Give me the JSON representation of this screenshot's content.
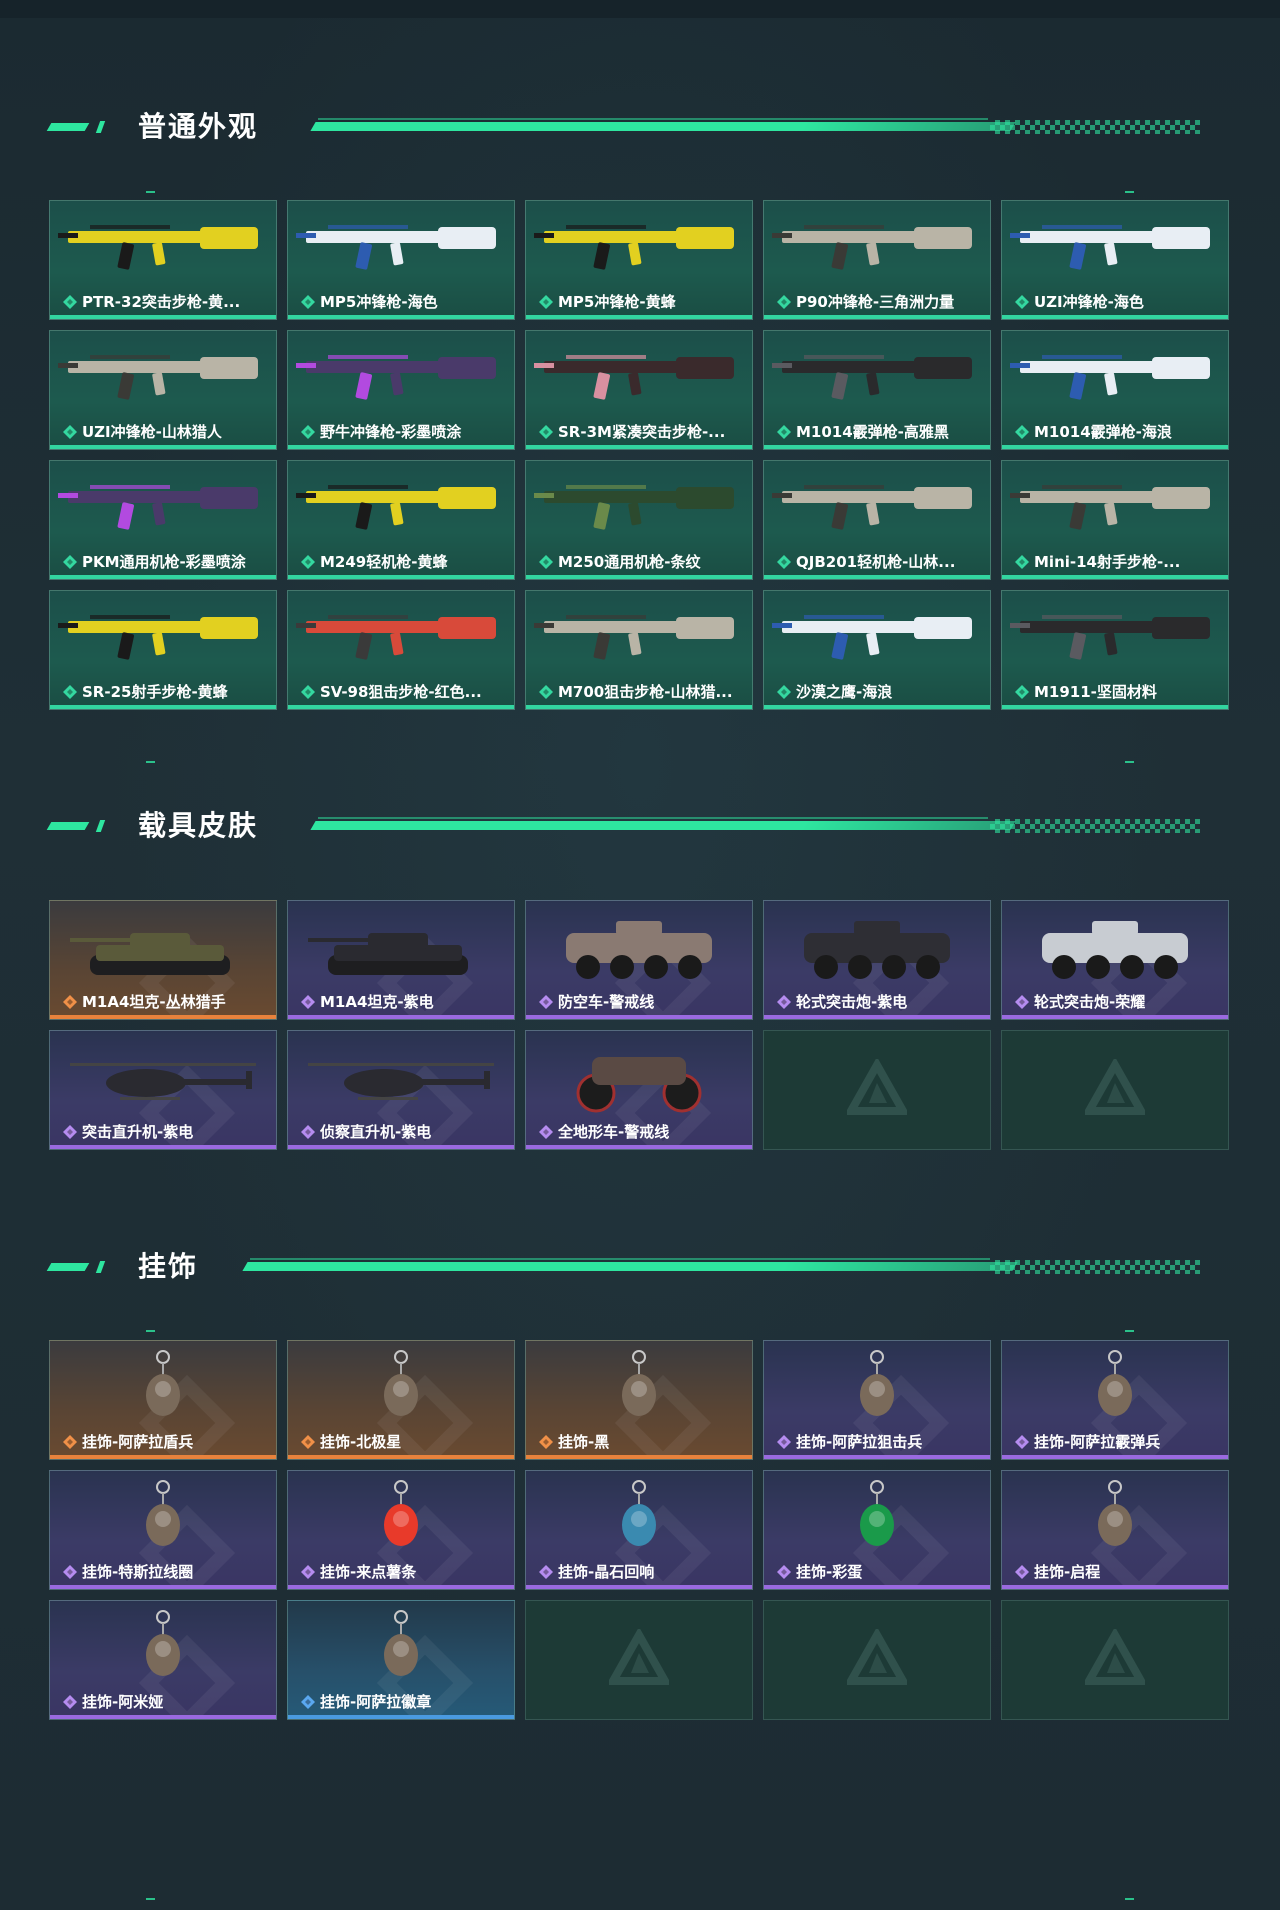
{
  "colors": {
    "accent": "#2ee6a0",
    "green_card": "#1d5a4e",
    "purple_card": "#3b3b66",
    "orange_card": "#6a4a30",
    "blue_card": "#255a78"
  },
  "sections": {
    "weapons": {
      "title": "普通外观",
      "items": [
        {
          "label": "PTR-32突击步枪-黄...",
          "rarity": "green",
          "icon": "rifle-yellow-icon"
        },
        {
          "label": "MP5冲锋枪-海色",
          "rarity": "green",
          "icon": "smg-white-blue-icon"
        },
        {
          "label": "MP5冲锋枪-黄蜂",
          "rarity": "green",
          "icon": "smg-yellow-icon"
        },
        {
          "label": "P90冲锋枪-三角洲力量",
          "rarity": "green",
          "icon": "p90-camo-icon"
        },
        {
          "label": "UZI冲锋枪-海色",
          "rarity": "green",
          "icon": "uzi-white-icon"
        },
        {
          "label": "UZI冲锋枪-山林猎人",
          "rarity": "green",
          "icon": "uzi-camo-icon"
        },
        {
          "label": "野牛冲锋枪-彩墨喷涂",
          "rarity": "green",
          "icon": "bizon-purple-icon"
        },
        {
          "label": "SR-3M紧凑突击步枪-...",
          "rarity": "green",
          "icon": "sr3m-pink-icon"
        },
        {
          "label": "M1014霰弹枪-高雅黑",
          "rarity": "green",
          "icon": "shotgun-black-icon"
        },
        {
          "label": "M1014霰弹枪-海浪",
          "rarity": "green",
          "icon": "shotgun-blue-icon"
        },
        {
          "label": "PKM通用机枪-彩墨喷涂",
          "rarity": "green",
          "icon": "pkm-purple-icon"
        },
        {
          "label": "M249轻机枪-黄蜂",
          "rarity": "green",
          "icon": "m249-yellow-icon"
        },
        {
          "label": "M250通用机枪-条纹",
          "rarity": "green",
          "icon": "m250-green-icon"
        },
        {
          "label": "QJB201轻机枪-山林...",
          "rarity": "green",
          "icon": "qjb201-camo-icon"
        },
        {
          "label": "Mini-14射手步枪-...",
          "rarity": "green",
          "icon": "mini14-camo-icon"
        },
        {
          "label": "SR-25射手步枪-黄蜂",
          "rarity": "green",
          "icon": "sr25-yellow-icon"
        },
        {
          "label": "SV-98狙击步枪-红色...",
          "rarity": "green",
          "icon": "sv98-red-icon"
        },
        {
          "label": "M700狙击步枪-山林猎...",
          "rarity": "green",
          "icon": "m700-camo-icon"
        },
        {
          "label": "沙漠之鹰-海浪",
          "rarity": "green",
          "icon": "deagle-blue-icon"
        },
        {
          "label": "M1911-坚固材料",
          "rarity": "green",
          "icon": "m1911-black-icon"
        }
      ]
    },
    "vehicles": {
      "title": "载具皮肤",
      "items": [
        {
          "label": "M1A4坦克-丛林猎手",
          "rarity": "orange",
          "icon": "tank-camo-icon"
        },
        {
          "label": "M1A4坦克-紫电",
          "rarity": "purple",
          "icon": "tank-dark-icon"
        },
        {
          "label": "防空车-警戒线",
          "rarity": "purple",
          "icon": "aa-vehicle-icon"
        },
        {
          "label": "轮式突击炮-紫电",
          "rarity": "purple",
          "icon": "wheeled-gun-dark-icon"
        },
        {
          "label": "轮式突击炮-荣耀",
          "rarity": "purple",
          "icon": "wheeled-gun-white-icon"
        },
        {
          "label": "突击直升机-紫电",
          "rarity": "purple",
          "icon": "attack-heli-icon"
        },
        {
          "label": "侦察直升机-紫电",
          "rarity": "purple",
          "icon": "scout-heli-icon"
        },
        {
          "label": "全地形车-警戒线",
          "rarity": "purple",
          "icon": "atv-icon"
        },
        {
          "label": "",
          "rarity": "empty",
          "icon": "empty-slot-icon"
        },
        {
          "label": "",
          "rarity": "empty",
          "icon": "empty-slot-icon"
        }
      ]
    },
    "charms": {
      "title": "挂饰",
      "items": [
        {
          "label": "挂饰-阿萨拉盾兵",
          "rarity": "orange",
          "icon": "charm-shield-soldier-icon"
        },
        {
          "label": "挂饰-北极星",
          "rarity": "orange",
          "icon": "charm-polaris-icon"
        },
        {
          "label": "挂饰-黑",
          "rarity": "orange",
          "icon": "charm-black-icon"
        },
        {
          "label": "挂饰-阿萨拉狙击兵",
          "rarity": "purple",
          "icon": "charm-sniper-icon"
        },
        {
          "label": "挂饰-阿萨拉霰弹兵",
          "rarity": "purple",
          "icon": "charm-shotgunner-icon"
        },
        {
          "label": "挂饰-特斯拉线圈",
          "rarity": "purple",
          "icon": "charm-tesla-coil-icon"
        },
        {
          "label": "挂饰-来点薯条",
          "rarity": "purple",
          "icon": "charm-fries-icon"
        },
        {
          "label": "挂饰-晶石回响",
          "rarity": "purple",
          "icon": "charm-crystal-icon"
        },
        {
          "label": "挂饰-彩蛋",
          "rarity": "purple",
          "icon": "charm-easter-egg-icon"
        },
        {
          "label": "挂饰-启程",
          "rarity": "purple",
          "icon": "charm-departure-icon"
        },
        {
          "label": "挂饰-阿米娅",
          "rarity": "purple",
          "icon": "charm-amiya-icon"
        },
        {
          "label": "挂饰-阿萨拉徽章",
          "rarity": "blue",
          "icon": "charm-badge-icon"
        },
        {
          "label": "",
          "rarity": "empty",
          "icon": "empty-slot-icon"
        },
        {
          "label": "",
          "rarity": "empty",
          "icon": "empty-slot-icon"
        },
        {
          "label": "",
          "rarity": "empty",
          "icon": "empty-slot-icon"
        }
      ]
    }
  }
}
